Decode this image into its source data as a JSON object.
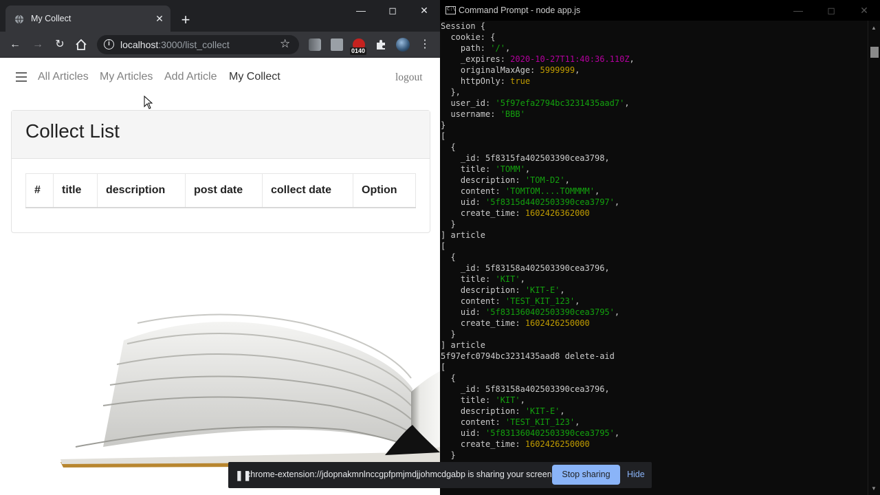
{
  "browser": {
    "tab_title": "My Collect",
    "tab_close": "✕",
    "new_tab": "+",
    "url_host": "localhost",
    "url_path": ":3000/list_collect",
    "extension_badge": "0140"
  },
  "nav": {
    "links": [
      "All Articles",
      "My Articles",
      "Add Article",
      "My Collect"
    ],
    "logout": "logout"
  },
  "card": {
    "title": "Collect List",
    "columns": [
      "#",
      "title",
      "description",
      "post date",
      "collect date",
      "Option"
    ]
  },
  "cmd": {
    "title": "Command Prompt - node  app.js",
    "lines": [
      [
        [
          "Session {",
          ""
        ]
      ],
      [
        [
          "  cookie: {",
          ""
        ]
      ],
      [
        [
          "    path: ",
          ""
        ],
        [
          "'/'",
          "str"
        ],
        [
          ",",
          ""
        ]
      ],
      [
        [
          "    _expires: ",
          ""
        ],
        [
          "2020-10-27T11:40:36.110Z",
          "date"
        ],
        [
          ",",
          ""
        ]
      ],
      [
        [
          "    originalMaxAge: ",
          ""
        ],
        [
          "5999999",
          "num"
        ],
        [
          ",",
          ""
        ]
      ],
      [
        [
          "    httpOnly: ",
          ""
        ],
        [
          "true",
          "num"
        ]
      ],
      [
        [
          "  },",
          ""
        ]
      ],
      [
        [
          "  user_id: ",
          ""
        ],
        [
          "'5f97efa2794bc3231435aad7'",
          "str"
        ],
        [
          ",",
          ""
        ]
      ],
      [
        [
          "  username: ",
          ""
        ],
        [
          "'BBB'",
          "str"
        ]
      ],
      [
        [
          "}",
          ""
        ]
      ],
      [
        [
          "[",
          ""
        ]
      ],
      [
        [
          "  {",
          ""
        ]
      ],
      [
        [
          "    _id: 5f8315fa402503390cea3798,",
          ""
        ]
      ],
      [
        [
          "    title: ",
          ""
        ],
        [
          "'TOMM'",
          "str"
        ],
        [
          ",",
          ""
        ]
      ],
      [
        [
          "    description: ",
          ""
        ],
        [
          "'TOM-D2'",
          "str"
        ],
        [
          ",",
          ""
        ]
      ],
      [
        [
          "    content: ",
          ""
        ],
        [
          "'TOMTOM....TOMMMM'",
          "str"
        ],
        [
          ",",
          ""
        ]
      ],
      [
        [
          "    uid: ",
          ""
        ],
        [
          "'5f8315d4402503390cea3797'",
          "str"
        ],
        [
          ",",
          ""
        ]
      ],
      [
        [
          "    create_time: ",
          ""
        ],
        [
          "1602426362000",
          "num"
        ]
      ],
      [
        [
          "  }",
          ""
        ]
      ],
      [
        [
          "] article",
          ""
        ]
      ],
      [
        [
          "[",
          ""
        ]
      ],
      [
        [
          "  {",
          ""
        ]
      ],
      [
        [
          "    _id: 5f83158a402503390cea3796,",
          ""
        ]
      ],
      [
        [
          "    title: ",
          ""
        ],
        [
          "'KIT'",
          "str"
        ],
        [
          ",",
          ""
        ]
      ],
      [
        [
          "    description: ",
          ""
        ],
        [
          "'KIT-E'",
          "str"
        ],
        [
          ",",
          ""
        ]
      ],
      [
        [
          "    content: ",
          ""
        ],
        [
          "'TEST_KIT_123'",
          "str"
        ],
        [
          ",",
          ""
        ]
      ],
      [
        [
          "    uid: ",
          ""
        ],
        [
          "'5f831360402503390cea3795'",
          "str"
        ],
        [
          ",",
          ""
        ]
      ],
      [
        [
          "    create_time: ",
          ""
        ],
        [
          "1602426250000",
          "num"
        ]
      ],
      [
        [
          "  }",
          ""
        ]
      ],
      [
        [
          "] article",
          ""
        ]
      ],
      [
        [
          "5f97efc0794bc3231435aad8 delete-aid",
          ""
        ]
      ],
      [
        [
          "[",
          ""
        ]
      ],
      [
        [
          "  {",
          ""
        ]
      ],
      [
        [
          "    _id: 5f83158a402503390cea3796,",
          ""
        ]
      ],
      [
        [
          "    title: ",
          ""
        ],
        [
          "'KIT'",
          "str"
        ],
        [
          ",",
          ""
        ]
      ],
      [
        [
          "    description: ",
          ""
        ],
        [
          "'KIT-E'",
          "str"
        ],
        [
          ",",
          ""
        ]
      ],
      [
        [
          "    content: ",
          ""
        ],
        [
          "'TEST_KIT_123'",
          "str"
        ],
        [
          ",",
          ""
        ]
      ],
      [
        [
          "    uid: ",
          ""
        ],
        [
          "'5f831360402503390cea3795'",
          "str"
        ],
        [
          ",",
          ""
        ]
      ],
      [
        [
          "    create_time: ",
          ""
        ],
        [
          "1602426250000",
          "num"
        ]
      ],
      [
        [
          "  }",
          ""
        ]
      ]
    ]
  },
  "share_bar": {
    "message": "chrome-extension://jdopnakmnlnccgpfpmjmdjjohmcdgabp is sharing your screen.",
    "stop_label": "Stop sharing",
    "hide_label": "Hide"
  },
  "colors": {
    "console_string": "#13a10e",
    "console_number": "#c19c00",
    "console_date": "#b4009e",
    "stop_button": "#8ab4f8"
  }
}
